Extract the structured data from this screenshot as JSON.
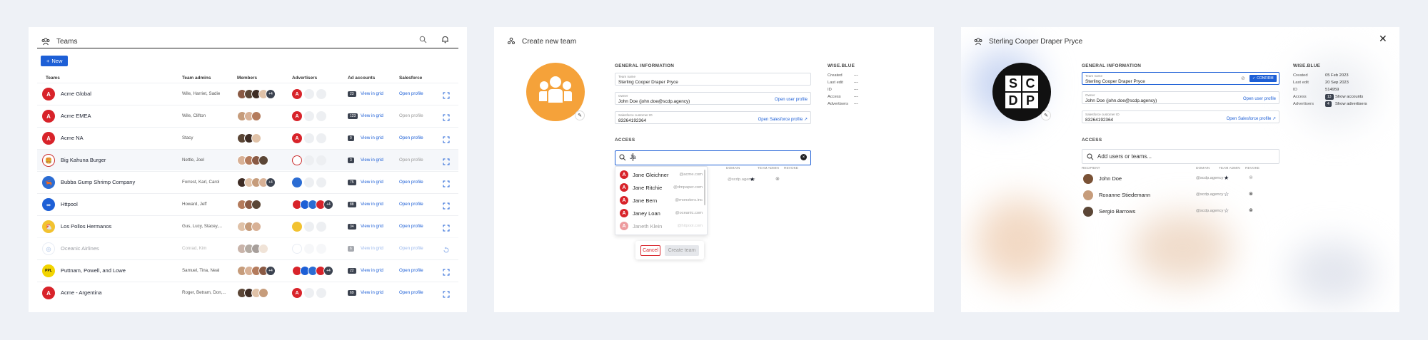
{
  "panel1": {
    "title": "Teams",
    "new_label": "New",
    "columns": [
      "Teams",
      "Team admins",
      "Members",
      "Advertisers",
      "Ad accounts",
      "Salesforce"
    ],
    "rows": [
      {
        "name": "Acme Global",
        "admins": "Wile, Harriet, Sadie",
        "logo": "acme",
        "members_more": "+4",
        "adv": "acme",
        "count": "23",
        "view": "View in grid",
        "open": "Open profile"
      },
      {
        "name": "Acme EMEA",
        "admins": "Wile, Clifton",
        "logo": "acme",
        "members_more": "",
        "adv": "acme",
        "count": "123",
        "view": "View in grid",
        "open": "Open profile"
      },
      {
        "name": "Acme NA",
        "admins": "Stacy",
        "logo": "acme",
        "members_more": "",
        "adv": "acme",
        "count": "0",
        "view": "View in grid",
        "open": "Open profile"
      },
      {
        "name": "Big Kahuna Burger",
        "admins": "Nettle, Joel",
        "logo": "kahuna",
        "members_more": "",
        "adv": "kahuna",
        "count": "3",
        "view": "View in grid",
        "open": "Open profile"
      },
      {
        "name": "Bubba Gump Shrimp Company",
        "admins": "Forrest, Karl, Carol",
        "logo": "bubba",
        "members_more": "+4",
        "adv": "bubba",
        "count": "75",
        "view": "View in grid",
        "open": "Open profile"
      },
      {
        "name": "Httpool",
        "admins": "Howard, Jeff",
        "logo": "httpool",
        "members_more": "",
        "adv": "multi",
        "count": "88",
        "view": "View in grid",
        "open": "Open profile"
      },
      {
        "name": "Los Pollos Hermanos",
        "admins": "Gus, Lucy, Stacey,...",
        "logo": "pollos",
        "members_more": "",
        "adv": "pollos",
        "count": "34",
        "view": "View in grid",
        "open": "Open profile"
      },
      {
        "name": "Oceanic Airlines",
        "admins": "Conrad, Kim",
        "logo": "oceanic",
        "members_more": "",
        "adv": "oceanic",
        "count": "6",
        "view": "View in grid",
        "open": "Open profile"
      },
      {
        "name": "Puttnam, Powell, and Lowe",
        "admins": "Samuel, Tina, Neal",
        "logo": "ppl",
        "members_more": "+4",
        "adv": "multi",
        "count": "22",
        "view": "View in grid",
        "open": "Open profile"
      },
      {
        "name": "Acme - Argentina",
        "admins": "Roger, Betram, Don,...",
        "logo": "acme",
        "members_more": "",
        "adv": "acme",
        "count": "69",
        "view": "View in grid",
        "open": "Open profile"
      }
    ],
    "adv_multi_more": "+4"
  },
  "panel2": {
    "title": "Create new team",
    "general_label": "GENERAL INFORMATION",
    "wise_label": "WISE.BLUE",
    "team_name_label": "Team name",
    "team_name_value": "Sterling Cooper Draper Pryce",
    "owner_label": "Owner",
    "owner_value": "John Doe (john.doe@scdp.agency)",
    "owner_link": "Open user profile",
    "sf_label": "Salesforce customer ID",
    "sf_value": "83264192364",
    "sf_link": "Open Salesforce profile",
    "meta_labels": [
      "Created",
      "Last edit",
      "ID",
      "Access",
      "Advertisers"
    ],
    "meta_values": [
      "---",
      "---",
      "---",
      "---",
      "---"
    ],
    "access_label": "ACCESS",
    "search_value": "Ja",
    "headers": [
      "DOMAIN",
      "TEAM ADMIN",
      "REVOKE"
    ],
    "row_domain": "@scdp.agency",
    "dropdown": [
      {
        "name": "Jane Gleichner",
        "domain": "@acme.com"
      },
      {
        "name": "Jane Ritchie",
        "domain": "@dmpaper.com"
      },
      {
        "name": "Jane Bern",
        "domain": "@monsters.inc"
      },
      {
        "name": "Janey Loan",
        "domain": "@oceanic.com"
      },
      {
        "name": "Janeth Klein",
        "domain": "@hitpool.com"
      }
    ],
    "cancel": "Cancel",
    "create": "Create team"
  },
  "panel3": {
    "title": "Sterling Cooper Draper Pryce",
    "logo_letters": [
      "S",
      "C",
      "D",
      "P"
    ],
    "general_label": "GENERAL INFORMATION",
    "wise_label": "WISE.BLUE",
    "team_name_label": "Team name",
    "team_name_value": "Sterling Cooper Draper Pryce",
    "confirm": "CONFIRM",
    "owner_label": "Owner",
    "owner_value": "John Doe (john.doe@scdp.agency)",
    "owner_link": "Open user profile",
    "sf_label": "Salesforce customer ID",
    "sf_value": "83264192364",
    "sf_link": "Open Salesforce profile",
    "meta_labels": [
      "Created",
      "Last edit",
      "ID",
      "Access",
      "Advertisers"
    ],
    "created": "05 Feb 2023",
    "last_edit": "20 Sep 2023",
    "id": "514959",
    "access_count": "13",
    "access_link": "Show accounts",
    "adv_count": "4",
    "adv_link": "Show advertisers",
    "access_label": "ACCESS",
    "search_placeholder": "Add users or teams...",
    "headers": [
      "RECIPIENT",
      "DOMAIN",
      "TEAM ADMIN",
      "REVOKE"
    ],
    "recipients": [
      {
        "name": "John Doe",
        "domain": "@scdp.agency",
        "admin": true
      },
      {
        "name": "Roxanne Stiedemann",
        "domain": "@scdp.agency",
        "admin": false
      },
      {
        "name": "Sergio Barrows",
        "domain": "@scdp.agency",
        "admin": false
      }
    ]
  },
  "colors": {
    "accent": "#1d5fd6",
    "acme": "#d8232a",
    "orange": "#f5a23a",
    "cancel": "#d8232a"
  }
}
